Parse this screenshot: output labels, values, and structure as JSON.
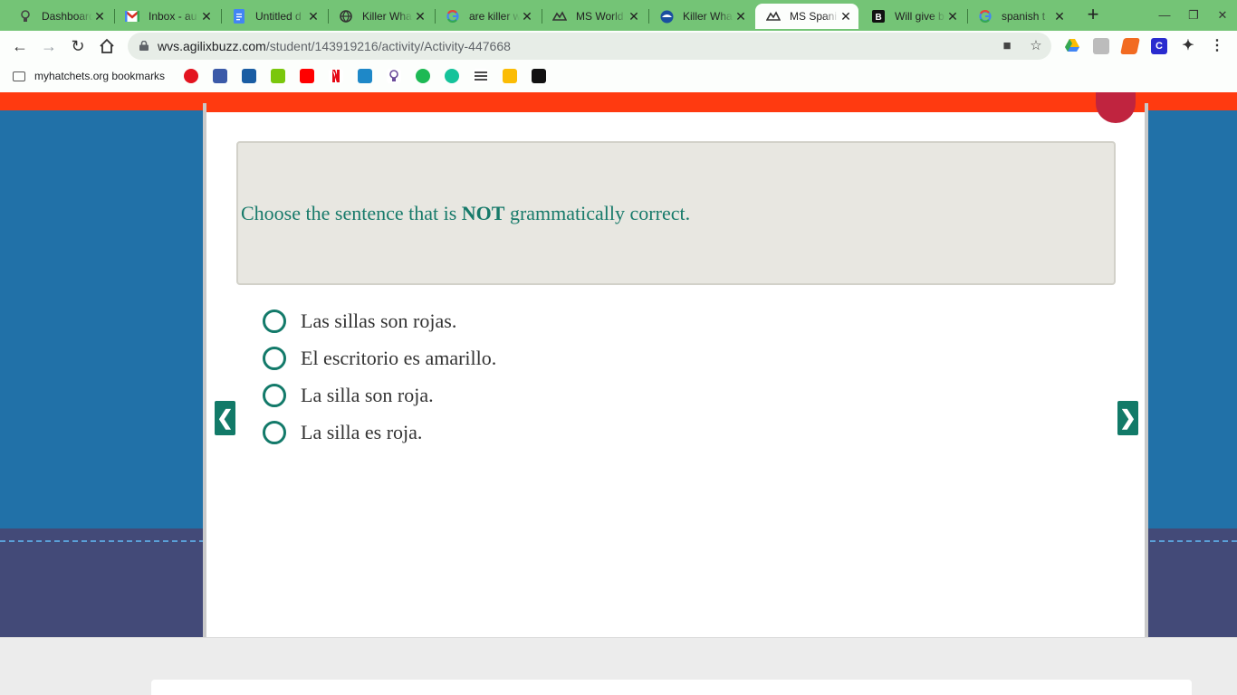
{
  "browser": {
    "tabs": [
      {
        "title": "Dashboard",
        "icon": "bulb-icon",
        "left": 0
      },
      {
        "title": "Inbox - au",
        "icon": "gmail-icon"
      },
      {
        "title": "Untitled d",
        "icon": "docs-icon"
      },
      {
        "title": "Killer Wha",
        "icon": "globe-icon"
      },
      {
        "title": "are killer w",
        "icon": "google-icon"
      },
      {
        "title": "MS World",
        "icon": "agilix-icon"
      },
      {
        "title": "Killer Wha",
        "icon": "noaa-icon"
      },
      {
        "title": "MS Spani",
        "icon": "agilix-icon",
        "active": true
      },
      {
        "title": "Will give b",
        "icon": "brainly-icon"
      },
      {
        "title": "spanish t",
        "icon": "google-icon"
      }
    ],
    "url_host": "wvs.agilixbuzz.com",
    "url_path": "/student/143919216/activity/Activity-447668",
    "bookmarks_folder": "myhatchets.org bookmarks"
  },
  "activity": {
    "question_prefix": "Choose the sentence that is ",
    "question_emphasis": "NOT",
    "question_suffix": " grammatically correct.",
    "options": [
      "Las sillas son rojas.",
      "El escritorio es amarillo.",
      "La silla son roja.",
      "La silla es roja."
    ],
    "prev_arrow": "❮",
    "next_arrow": "❯"
  },
  "colors": {
    "tabstrip": "#74c476",
    "page_bg": "#2171a8",
    "accent_teal": "#137a6a",
    "banner_red": "#ff3a10"
  }
}
